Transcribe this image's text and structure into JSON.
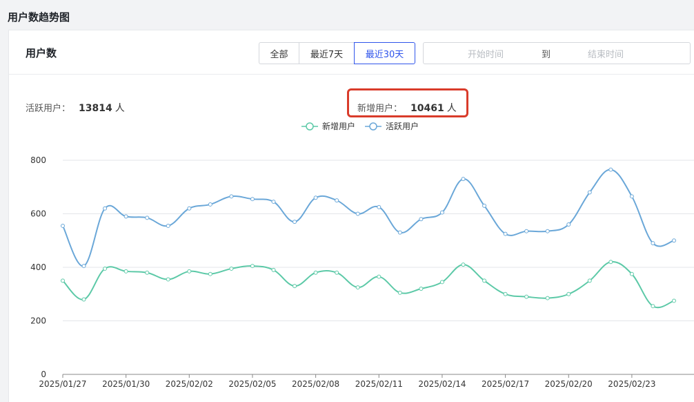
{
  "page_title": "用户数趋势图",
  "card": {
    "title": "用户数",
    "range_buttons": [
      "全部",
      "最近7天",
      "最近30天"
    ],
    "selected_range": "最近30天",
    "date_range": {
      "start_placeholder": "开始时间",
      "separator": "到",
      "end_placeholder": "结束时间"
    }
  },
  "stats": {
    "active": {
      "label": "活跃用户：",
      "value": "13814",
      "unit": "人"
    },
    "new": {
      "label": "新增用户：",
      "value": "10461",
      "unit": "人"
    }
  },
  "colors": {
    "new_users": "#5cc9a7",
    "active_users": "#6aa7d8",
    "accent": "#2f54eb",
    "highlight": "#d93b2a"
  },
  "chart_data": {
    "type": "line",
    "x": [
      "2025/01/27",
      "2025/01/28",
      "2025/01/29",
      "2025/01/30",
      "2025/01/31",
      "2025/02/01",
      "2025/02/02",
      "2025/02/03",
      "2025/02/04",
      "2025/02/05",
      "2025/02/06",
      "2025/02/07",
      "2025/02/08",
      "2025/02/09",
      "2025/02/10",
      "2025/02/11",
      "2025/02/12",
      "2025/02/13",
      "2025/02/14",
      "2025/02/15",
      "2025/02/16",
      "2025/02/17",
      "2025/02/18",
      "2025/02/19",
      "2025/02/20",
      "2025/02/21",
      "2025/02/22",
      "2025/02/23",
      "2025/02/24",
      "2025/02/25"
    ],
    "tick_labels": [
      "2025/01/27",
      "2025/01/30",
      "2025/02/02",
      "2025/02/05",
      "2025/02/08",
      "2025/02/11",
      "2025/02/14",
      "2025/02/17",
      "2025/02/20",
      "2025/02/23"
    ],
    "series": [
      {
        "name": "新增用户",
        "values": [
          350,
          280,
          395,
          385,
          380,
          355,
          385,
          375,
          395,
          405,
          390,
          330,
          380,
          380,
          325,
          365,
          305,
          320,
          345,
          410,
          350,
          300,
          290,
          285,
          300,
          350,
          420,
          375,
          255,
          275
        ]
      },
      {
        "name": "活跃用户",
        "values": [
          555,
          405,
          620,
          590,
          585,
          555,
          620,
          635,
          665,
          655,
          645,
          570,
          660,
          650,
          600,
          625,
          530,
          580,
          605,
          730,
          630,
          525,
          535,
          535,
          560,
          680,
          765,
          665,
          490,
          500
        ]
      }
    ],
    "ylim": [
      0,
      800
    ],
    "yticks": [
      0,
      200,
      400,
      600,
      800
    ],
    "grid": true,
    "legend_position": "top-center"
  }
}
